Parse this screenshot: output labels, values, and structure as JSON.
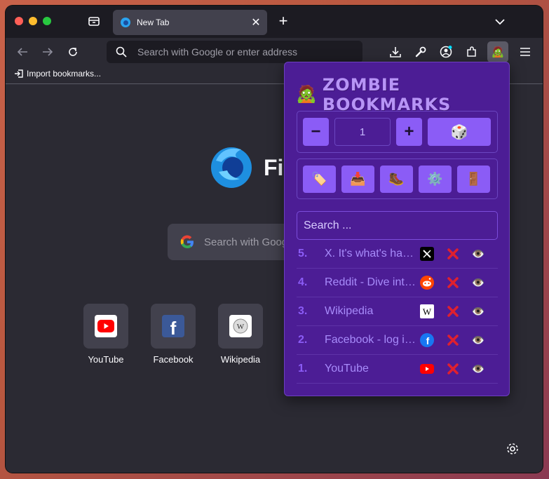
{
  "browser": {
    "tab_title": "New Tab",
    "url_placeholder": "Search with Google or enter address",
    "bookmarks_bar": {
      "import_label": "Import bookmarks..."
    },
    "newtab": {
      "brand_partial": "Fi",
      "search_placeholder": "Search with Goog",
      "top_sites": [
        {
          "label": "YouTube",
          "icon": "youtube-icon"
        },
        {
          "label": "Facebook",
          "icon": "facebook-icon"
        },
        {
          "label": "Wikipedia",
          "icon": "wikipedia-icon"
        }
      ]
    }
  },
  "popup": {
    "title": "ZOMBIE BOOKMARKS",
    "title_icon": "zombie-icon",
    "count_value": "1",
    "action_icons": [
      "label-tag-icon",
      "inbox-tray-icon",
      "boot-icon",
      "gear-icon",
      "door-icon"
    ],
    "search_placeholder": "Search ...",
    "bookmarks": [
      {
        "num": "5.",
        "title": "X. It's what's happening",
        "favicon": "x-icon"
      },
      {
        "num": "4.",
        "title": "Reddit - Dive into anything",
        "favicon": "reddit-icon"
      },
      {
        "num": "3.",
        "title": "Wikipedia",
        "favicon": "wikipedia-icon"
      },
      {
        "num": "2.",
        "title": "Facebook - log in or sign up",
        "favicon": "facebook-icon"
      },
      {
        "num": "1.",
        "title": "YouTube",
        "favicon": "youtube-icon"
      }
    ],
    "colors": {
      "background": "#4c1d95",
      "button": "#8b5cf6",
      "title": "#b794f6"
    }
  }
}
